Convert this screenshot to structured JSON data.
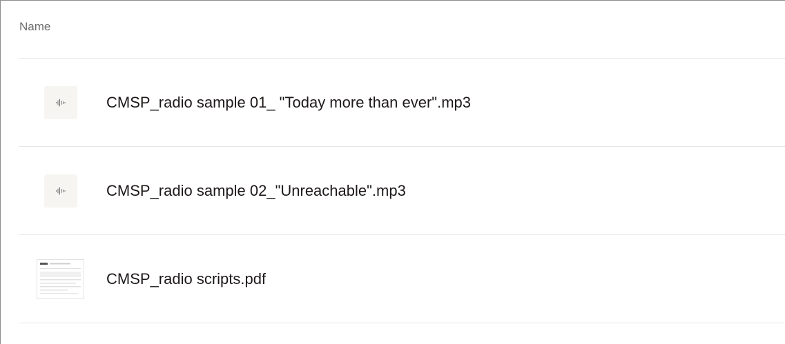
{
  "file_list": {
    "header": {
      "name_column": "Name"
    },
    "files": [
      {
        "name": "CMSP_radio sample 01_ \"Today more than ever\".mp3",
        "icon": "audio-waveform-icon"
      },
      {
        "name": "CMSP_radio sample 02_\"Unreachable\".mp3",
        "icon": "audio-waveform-icon"
      },
      {
        "name": "CMSP_radio scripts.pdf",
        "icon": "pdf-thumbnail"
      }
    ]
  },
  "colors": {
    "border": "#e6e6e6",
    "header_text": "#6b6b6b",
    "text": "#1e1919",
    "icon_bg": "#f7f5f2",
    "icon_fg": "#6b6b6b"
  }
}
